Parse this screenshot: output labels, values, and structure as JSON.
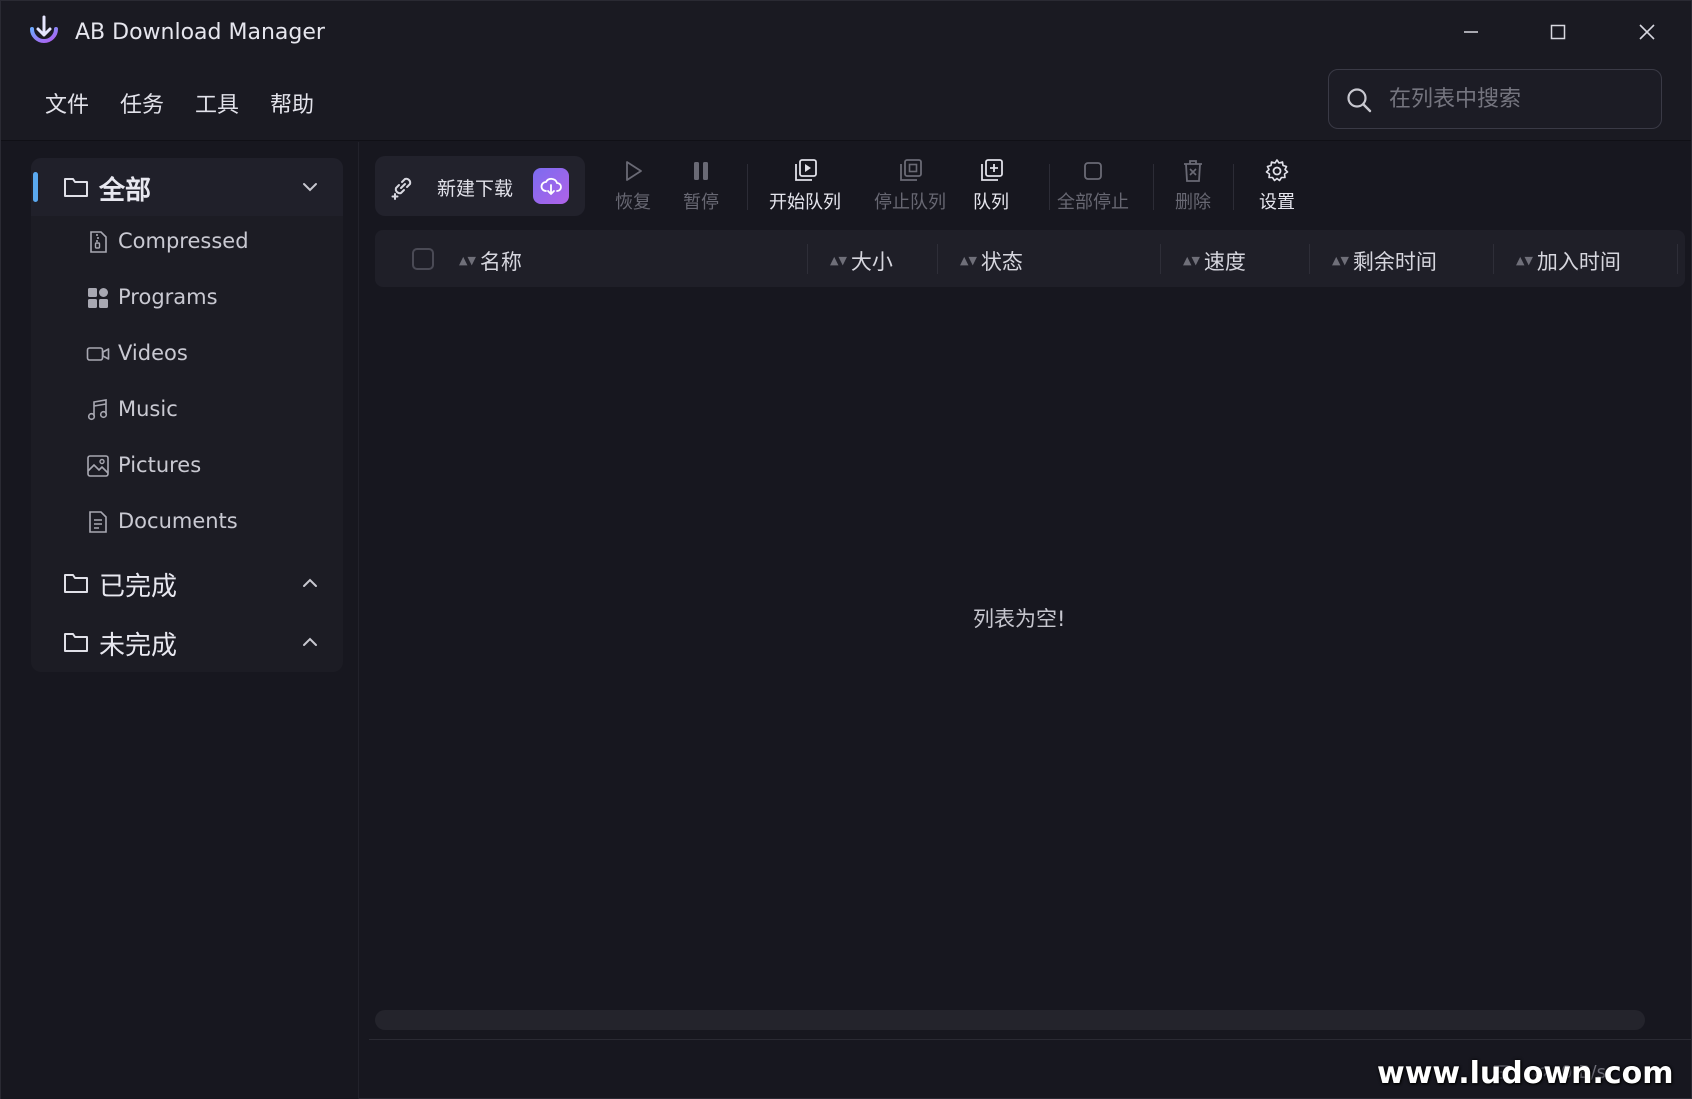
{
  "window": {
    "title": "AB Download Manager"
  },
  "menu": {
    "file": "文件",
    "tasks": "任务",
    "tools": "工具",
    "help": "帮助"
  },
  "search": {
    "placeholder": "在列表中搜索"
  },
  "sidebar": {
    "all": {
      "label": "全部"
    },
    "items": [
      {
        "label": "Compressed",
        "icon": "compressed-icon"
      },
      {
        "label": "Programs",
        "icon": "programs-icon"
      },
      {
        "label": "Videos",
        "icon": "videos-icon"
      },
      {
        "label": "Music",
        "icon": "music-icon"
      },
      {
        "label": "Pictures",
        "icon": "pictures-icon"
      },
      {
        "label": "Documents",
        "icon": "documents-icon"
      }
    ],
    "finished": {
      "label": "已完成"
    },
    "unfinished": {
      "label": "未完成"
    }
  },
  "toolbar": {
    "new_download": "新建下载",
    "resume": "恢复",
    "pause": "暂停",
    "start_queue": "开始队列",
    "stop_queue": "停止队列",
    "queue": "队列",
    "stop_all": "全部停止",
    "delete": "删除",
    "settings": "设置"
  },
  "table": {
    "columns": [
      "名称",
      "大小",
      "状态",
      "速度",
      "剩余时间",
      "加入时间"
    ],
    "empty_message": "列表为空!"
  },
  "status": {
    "speed": "0",
    "unit": "B/s"
  },
  "watermark": "www.ludown.com",
  "colors": {
    "accent": "#5aa9f0",
    "background": "#17171f",
    "brand_gradient_start": "#7b6cf0",
    "brand_gradient_end": "#b062e8"
  }
}
